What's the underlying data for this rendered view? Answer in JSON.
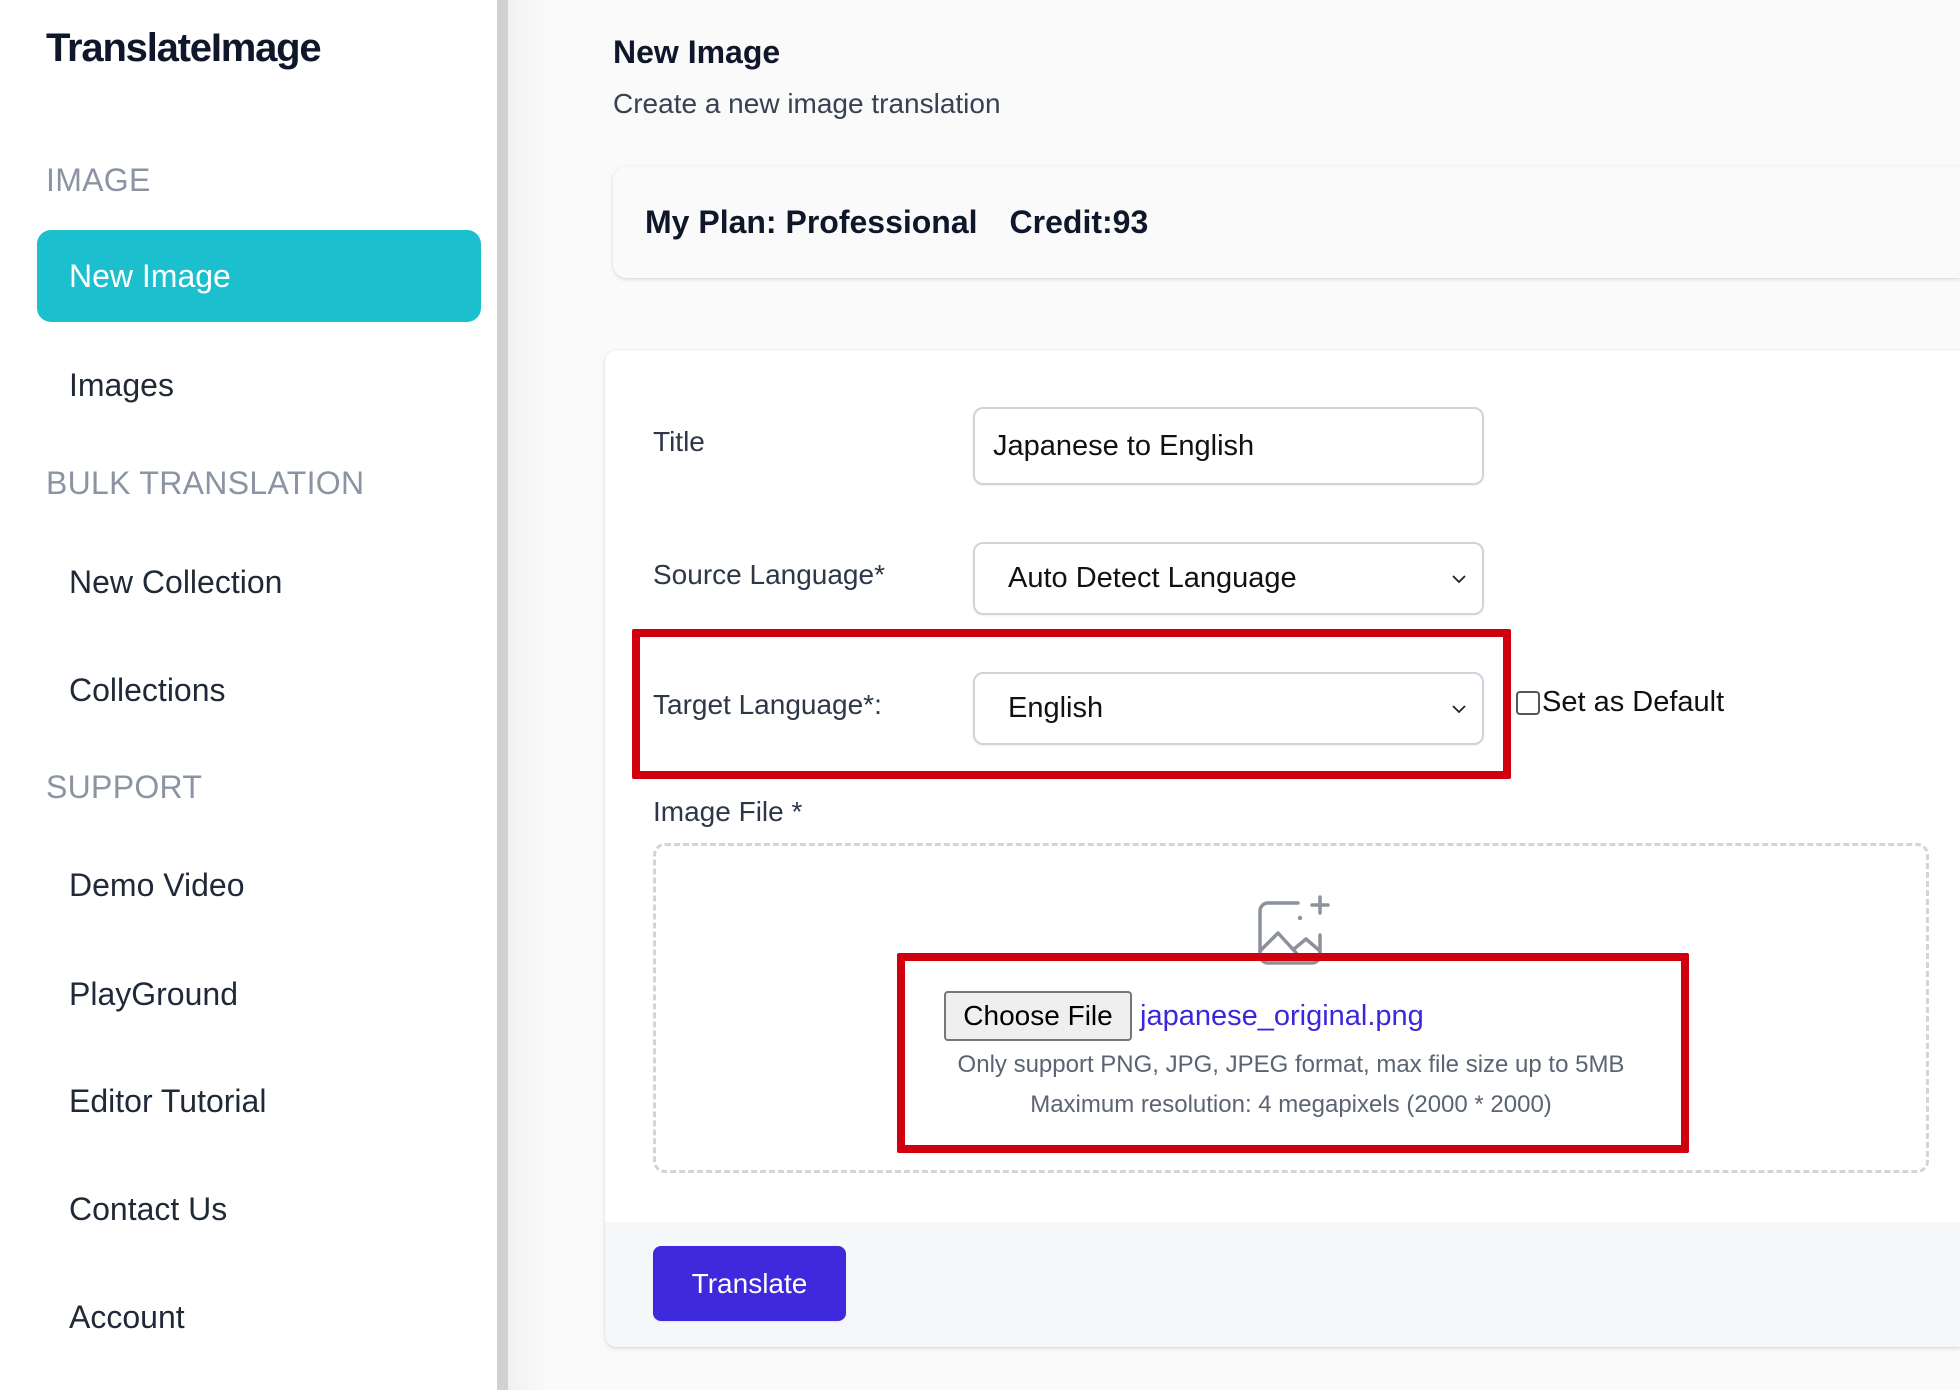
{
  "app": {
    "name": "TranslateImage"
  },
  "colors": {
    "accent": "#1bbfce",
    "primary_button": "#3f29dc",
    "highlight_box": "#d0000f",
    "file_name": "#3b27db"
  },
  "sidebar": {
    "sections": [
      {
        "title": "IMAGE",
        "items": [
          {
            "label": "New Image",
            "active": true
          },
          {
            "label": "Images",
            "active": false
          }
        ]
      },
      {
        "title": "BULK TRANSLATION",
        "items": [
          {
            "label": "New Collection",
            "active": false
          },
          {
            "label": "Collections",
            "active": false
          }
        ]
      },
      {
        "title": "SUPPORT",
        "items": [
          {
            "label": "Demo Video",
            "active": false
          },
          {
            "label": "PlayGround",
            "active": false
          },
          {
            "label": "Editor Tutorial",
            "active": false
          },
          {
            "label": "Contact Us",
            "active": false
          },
          {
            "label": "Account",
            "active": false
          }
        ]
      }
    ]
  },
  "header": {
    "title": "New Image",
    "subtitle": "Create a new image translation"
  },
  "plan": {
    "plan_text": "My Plan: Professional",
    "credit_text": "Credit:93"
  },
  "form": {
    "title": {
      "label": "Title",
      "value": "Japanese to English"
    },
    "source_language": {
      "label": "Source Language*",
      "value": "Auto Detect Language",
      "icon": "chevron-down-icon"
    },
    "target_language": {
      "label": "Target Language*:",
      "value": "English",
      "icon": "chevron-down-icon"
    },
    "set_default": {
      "label": "Set as Default",
      "checked": false
    },
    "image_file": {
      "label": "Image File *",
      "icon": "image-add-icon",
      "button_label": "Choose File",
      "file_name": "japanese_original.png",
      "hint_format": "Only support PNG, JPG, JPEG format, max file size up to 5MB",
      "hint_resolution": "Maximum resolution: 4 megapixels (2000 * 2000)"
    },
    "submit_label": "Translate"
  }
}
